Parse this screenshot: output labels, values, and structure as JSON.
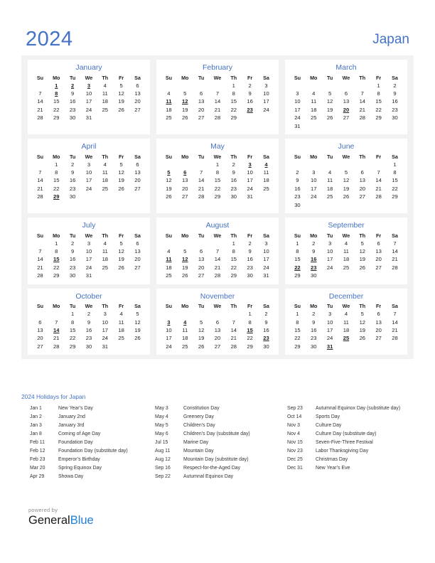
{
  "header": {
    "year": "2024",
    "country": "Japan"
  },
  "weekday_headers": [
    "Su",
    "Mo",
    "Tu",
    "We",
    "Th",
    "Fr",
    "Sa"
  ],
  "months": [
    {
      "name": "January",
      "lead_blanks": 1,
      "days": 31,
      "holidays": [
        1,
        2,
        3,
        8
      ]
    },
    {
      "name": "February",
      "lead_blanks": 4,
      "days": 29,
      "holidays": [
        11,
        12,
        23
      ]
    },
    {
      "name": "March",
      "lead_blanks": 5,
      "days": 31,
      "holidays": [
        20
      ]
    },
    {
      "name": "April",
      "lead_blanks": 1,
      "days": 30,
      "holidays": [
        29
      ]
    },
    {
      "name": "May",
      "lead_blanks": 3,
      "days": 31,
      "holidays": [
        3,
        4,
        5,
        6
      ]
    },
    {
      "name": "June",
      "lead_blanks": 6,
      "days": 30,
      "holidays": []
    },
    {
      "name": "July",
      "lead_blanks": 1,
      "days": 31,
      "holidays": [
        15
      ]
    },
    {
      "name": "August",
      "lead_blanks": 4,
      "days": 31,
      "holidays": [
        11,
        12
      ]
    },
    {
      "name": "September",
      "lead_blanks": 0,
      "days": 30,
      "holidays": [
        16,
        22,
        23
      ]
    },
    {
      "name": "October",
      "lead_blanks": 2,
      "days": 31,
      "holidays": [
        14
      ]
    },
    {
      "name": "November",
      "lead_blanks": 5,
      "days": 30,
      "holidays": [
        3,
        4,
        15,
        23
      ]
    },
    {
      "name": "December",
      "lead_blanks": 0,
      "days": 31,
      "holidays": [
        25,
        31
      ]
    }
  ],
  "holidays_section": {
    "title": "2024 Holidays for Japan",
    "columns": [
      [
        {
          "date": "Jan 1",
          "name": "New Year’s Day"
        },
        {
          "date": "Jan 2",
          "name": "January 2nd"
        },
        {
          "date": "Jan 3",
          "name": "January 3rd"
        },
        {
          "date": "Jan 8",
          "name": "Coming of Age Day"
        },
        {
          "date": "Feb 11",
          "name": "Foundation Day"
        },
        {
          "date": "Feb 12",
          "name": "Foundation Day (substitute day)"
        },
        {
          "date": "Feb 23",
          "name": "Emperor’s Birthday"
        },
        {
          "date": "Mar 20",
          "name": "Spring Equinox Day"
        },
        {
          "date": "Apr 29",
          "name": "Showa Day"
        }
      ],
      [
        {
          "date": "May 3",
          "name": "Constitution Day"
        },
        {
          "date": "May 4",
          "name": "Greenery Day"
        },
        {
          "date": "May 5",
          "name": "Children’s Day"
        },
        {
          "date": "May 6",
          "name": "Children’s Day (substitute day)"
        },
        {
          "date": "Jul 15",
          "name": "Marine Day"
        },
        {
          "date": "Aug 11",
          "name": "Mountain Day"
        },
        {
          "date": "Aug 12",
          "name": "Mountain Day (substitute day)"
        },
        {
          "date": "Sep 16",
          "name": "Respect-for-the-Aged Day"
        },
        {
          "date": "Sep 22",
          "name": "Autumnal Equinox Day"
        }
      ],
      [
        {
          "date": "Sep 23",
          "name": "Autumnal Equinox Day (substitute day)"
        },
        {
          "date": "Oct 14",
          "name": "Sports Day"
        },
        {
          "date": "Nov 3",
          "name": "Culture Day"
        },
        {
          "date": "Nov 4",
          "name": "Culture Day (substitute day)"
        },
        {
          "date": "Nov 15",
          "name": "Seven-Five-Three Festival"
        },
        {
          "date": "Nov 23",
          "name": "Labor Thanksgiving Day"
        },
        {
          "date": "Dec 25",
          "name": "Christmas Day"
        },
        {
          "date": "Dec 31",
          "name": "New Year’s Eve"
        }
      ]
    ]
  },
  "footer": {
    "powered_by": "powered by",
    "brand_first": "General",
    "brand_second": "Blue"
  },
  "colors": {
    "accent_blue": "#4472c4",
    "holiday_red": "#e8090b",
    "panel_bg": "#f2f2f2",
    "brand_blue": "#1f7fd4"
  }
}
